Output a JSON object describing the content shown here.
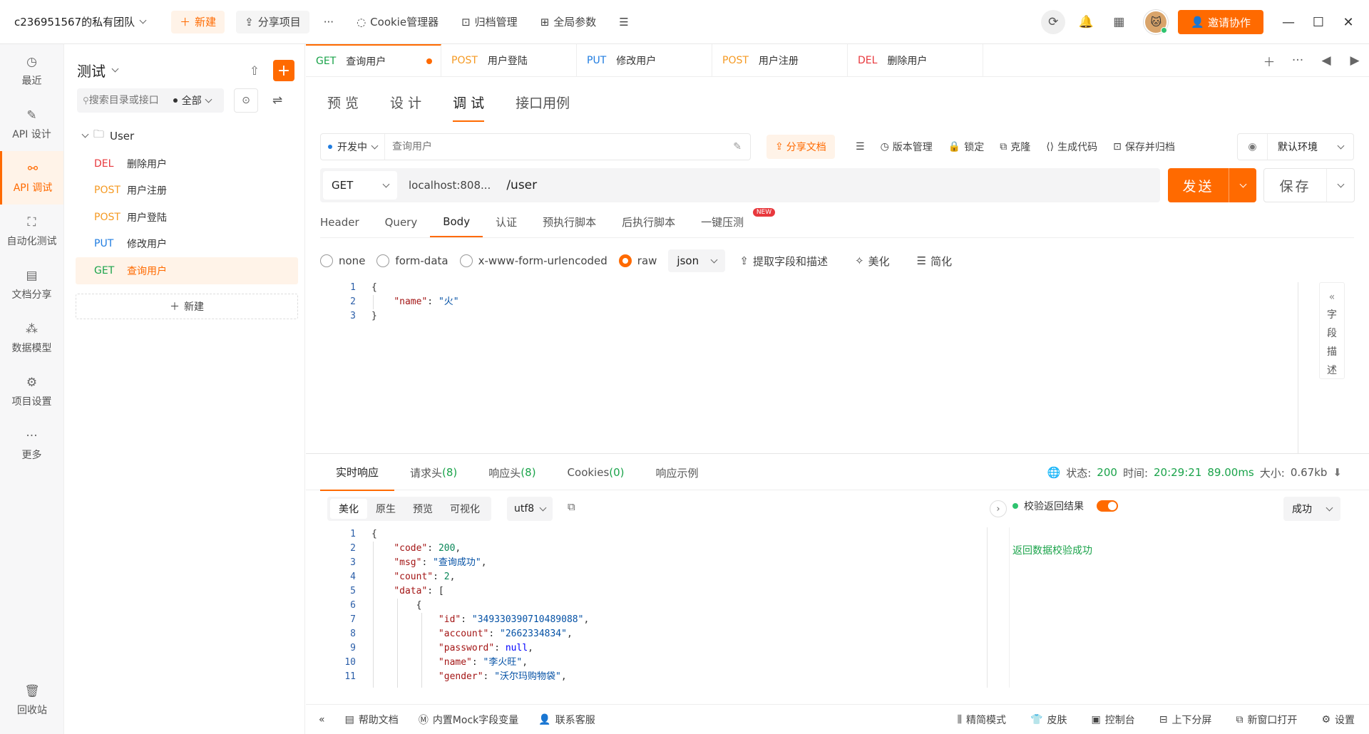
{
  "topbar": {
    "team": "c236951567的私有团队",
    "new_btn": "新建",
    "share_btn": "分享项目",
    "more": "···",
    "cookie": "Cookie管理器",
    "archive": "归档管理",
    "params": "全局参数",
    "invite": "邀请协作"
  },
  "rail": [
    {
      "label": "最近",
      "icon": "clock-icon",
      "glyph": "◷"
    },
    {
      "label": "API 设计",
      "icon": "edit-icon",
      "glyph": "✎"
    },
    {
      "label": "API 调试",
      "icon": "link-icon",
      "glyph": "⚯"
    },
    {
      "label": "自动化测试",
      "icon": "flow-icon",
      "glyph": "⛶"
    },
    {
      "label": "文档分享",
      "icon": "doc-icon",
      "glyph": "▤"
    },
    {
      "label": "数据模型",
      "icon": "model-icon",
      "glyph": "⁂"
    },
    {
      "label": "项目设置",
      "icon": "settings-icon",
      "glyph": "⚙"
    },
    {
      "label": "更多",
      "icon": "more-icon",
      "glyph": "···"
    }
  ],
  "rail_bottom": {
    "label": "回收站",
    "glyph": "🗑"
  },
  "sidebar": {
    "project": "测试",
    "search_placeholder": "搜索目录或接口",
    "scope": "全部",
    "folder": "User",
    "items": [
      {
        "method": "DEL",
        "name": "删除用户"
      },
      {
        "method": "POST",
        "name": "用户注册"
      },
      {
        "method": "POST",
        "name": "用户登陆"
      },
      {
        "method": "PUT",
        "name": "修改用户"
      },
      {
        "method": "GET",
        "name": "查询用户"
      }
    ],
    "new": "新建"
  },
  "tabs": [
    {
      "method": "GET",
      "name": "查询用户"
    },
    {
      "method": "POST",
      "name": "用户登陆"
    },
    {
      "method": "PUT",
      "name": "修改用户"
    },
    {
      "method": "POST",
      "name": "用户注册"
    },
    {
      "method": "DEL",
      "name": "删除用户"
    }
  ],
  "subtabs": [
    "预 览",
    "设 计",
    "调 试",
    "接口用例"
  ],
  "request": {
    "status": "开发中",
    "name_placeholder": "查询用户",
    "share_doc": "分享文档",
    "tools": [
      "版本管理",
      "锁定",
      "克隆",
      "生成代码",
      "保存并归档"
    ],
    "env": "默认环境",
    "method": "GET",
    "host": "localhost:808...",
    "path": "/user",
    "send": "发送",
    "save": "保存"
  },
  "param_tabs": [
    "Header",
    "Query",
    "Body",
    "认证",
    "预执行脚本",
    "后执行脚本",
    "一键压测"
  ],
  "new_badge": "NEW",
  "body_types": [
    "none",
    "form-data",
    "x-www-form-urlencoded",
    "raw"
  ],
  "body_format": "json",
  "body_tools": [
    "提取字段和描述",
    "美化",
    "简化"
  ],
  "field_desc": [
    "字",
    "段",
    "描",
    "述"
  ],
  "response": {
    "tabs": [
      {
        "label": "实时响应",
        "count": ""
      },
      {
        "label": "请求头",
        "count": "(8)"
      },
      {
        "label": "响应头",
        "count": "(8)"
      },
      {
        "label": "Cookies",
        "count": "(0)"
      },
      {
        "label": "响应示例",
        "count": ""
      }
    ],
    "status_label": "状态:",
    "status": "200",
    "time_label": "时间:",
    "time": "20:29:21",
    "duration": "89.00ms",
    "size_label": "大小:",
    "size": "0.67kb",
    "views": [
      "美化",
      "原生",
      "预览",
      "可视化"
    ],
    "encoding": "utf8",
    "validate": "校验返回结果",
    "result_sel": "成功",
    "validate_msg": "返回数据校验成功"
  },
  "statusbar": {
    "left": [
      "帮助文档",
      "内置Mock字段变量",
      "联系客服"
    ],
    "right": [
      "精简模式",
      "皮肤",
      "控制台",
      "上下分屏",
      "新窗口打开",
      "设置"
    ]
  }
}
